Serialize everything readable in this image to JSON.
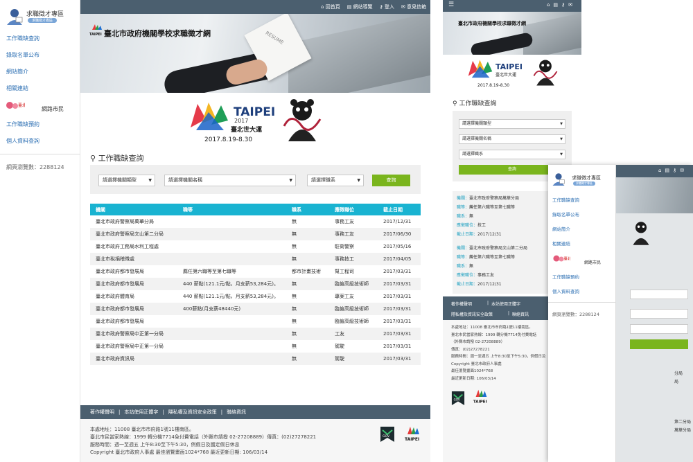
{
  "sidebar": {
    "title": "求職徵才專區",
    "subtitle": "求職徵才專區",
    "items": [
      "工作職缺查詢",
      "錄取名單公布",
      "網站簡介",
      "相關連結",
      "工作職缺預約",
      "個人資料查詢"
    ],
    "badge_text": "網路市民",
    "visit_count": "網頁瀏覽數：2288124"
  },
  "topnav": {
    "items": [
      "回首頁",
      "網站導覽",
      "登入",
      "意見信箱"
    ]
  },
  "hero": {
    "title": "臺北市政府機關學校求職徵才網",
    "paper_text": "RESUME",
    "logo_text": "TAIPEI"
  },
  "universiade": {
    "brand": "TAIPEI",
    "year": "2017",
    "name": "臺北世大運",
    "date": "2017.8.19-8.30"
  },
  "search": {
    "title": "工作職缺查詢",
    "select_type": "請選擇機關類型",
    "select_name": "請選擇機關名稱",
    "select_series": "請選擇職系",
    "button": "查詢"
  },
  "table": {
    "headers": [
      "機關",
      "職等",
      "職系",
      "應徵職位",
      "截止日期"
    ],
    "rows": [
      [
        "臺北市政府警察局萬華分局",
        "",
        "無",
        "事務工友",
        "2017/12/31"
      ],
      [
        "臺北市政府警察局文山第二分局",
        "",
        "無",
        "事務工友",
        "2017/06/30"
      ],
      [
        "臺北市政府工務局水利工程處",
        "",
        "無",
        "駐衛警察",
        "2017/05/16"
      ],
      [
        "臺北市稅捐稽徵處",
        "",
        "無",
        "事務技工",
        "2017/04/05"
      ],
      [
        "臺北市政府都市發展局",
        "薦任第六職等至第七職等",
        "都市計畫技術",
        "幫工程司",
        "2017/03/31"
      ],
      [
        "臺北市政府都市發展局",
        "440 薪點(121.1元/點，月支薪53,284元)。",
        "無",
        "臨僱高級技術師",
        "2017/03/31"
      ],
      [
        "臺北市政府體育局",
        "440 薪點(121.1元/點，月支薪53,284元)。",
        "無",
        "專案工友",
        "2017/03/31"
      ],
      [
        "臺北市政府都市發展局",
        "400薪點(月支薪48440元)",
        "無",
        "臨僱高級技術師",
        "2017/03/31"
      ],
      [
        "臺北市政府都市發展局",
        "",
        "無",
        "臨僱高級技術師",
        "2017/03/31"
      ],
      [
        "臺北市政府警察局中正第一分局",
        "",
        "無",
        "工友",
        "2017/03/31"
      ],
      [
        "臺北市政府警察局中正第一分局",
        "",
        "無",
        "駕駛",
        "2017/03/31"
      ],
      [
        "臺北市政府資訊局",
        "",
        "無",
        "駕駛",
        "2017/03/31"
      ]
    ]
  },
  "footer": {
    "links": [
      "著作權聲明",
      "本站使用正體字",
      "隱私權及資訊安全政策",
      "聯絡資訊"
    ],
    "separator": "|",
    "info": [
      "本處地址：11008 臺北市市府路1號11樓南區。",
      "臺北市民當家熱線：1999 轉分機7714免付費電話（外縣市請撥 02-27208889）傳真：(02)27278221",
      "服務時間：週一至週五 上午8:30至下午5:30，例假日及國定假日休息",
      "Copyright 臺北市政府人事處    最佳瀏覽畫面1024*768    最近更新日期: 106/03/14"
    ],
    "gov_badge": "GOV",
    "taipei_badge": "TAIPEI"
  },
  "mobile": {
    "search_title": "工作職缺查詢",
    "records": [
      {
        "agency_label": "機關：",
        "agency": "臺北市政府警察局萬華分局",
        "grade_label": "職等：",
        "grade": "薦任第六職等至第七職等",
        "series_label": "職系：",
        "series": "無",
        "position_label": "應徵職位：",
        "position": "技工",
        "deadline_label": "截止日期：",
        "deadline": "2017/12/31"
      },
      {
        "agency_label": "機關：",
        "agency": "臺北市政府警察局文山第二分局",
        "grade_label": "職等：",
        "grade": "薦任第六職等至第七職等",
        "series_label": "職系：",
        "series": "無",
        "position_label": "應徵職位：",
        "position": "事務工友",
        "deadline_label": "截止日期：",
        "deadline": "2017/12/31"
      }
    ],
    "footer_links": [
      "著作權聲明",
      "本站使用正體字",
      "隱私權及資訊安全政策",
      "聯絡資訊"
    ],
    "footer_info": [
      "本處地址：11008 臺北市市府路1號11樓南區。",
      "臺北市民當家熱線：1999 轉分機7714免付費電話",
      "（外縣市請撥 02-27208889）",
      "傳真：(02)27278221",
      "服務時間：週一至週五 上午8:30至下午5:30，例假日及",
      "Copyright 臺北市政府人事處",
      "最佳瀏覽畫面1024*768",
      "最近更新日期: 106/03/14"
    ]
  },
  "overlay": {
    "title": "求職徵才專區",
    "subtitle": "求職徵才專區",
    "items": [
      "工作職缺查詢",
      "錄取名單公布",
      "網站簡介",
      "相關連結",
      "工作職缺預約",
      "個人資料查詢"
    ],
    "badge_text": "網路市民",
    "visit_count": "網頁瀏覽數：2288124",
    "bg_rows": [
      "分局",
      "局",
      "第二分局",
      "萬華分局"
    ]
  },
  "colors": {
    "topbar": "#4b5f6f",
    "table_header": "#19b3d1",
    "button": "#7ab51d",
    "link": "#2c6fb3"
  }
}
